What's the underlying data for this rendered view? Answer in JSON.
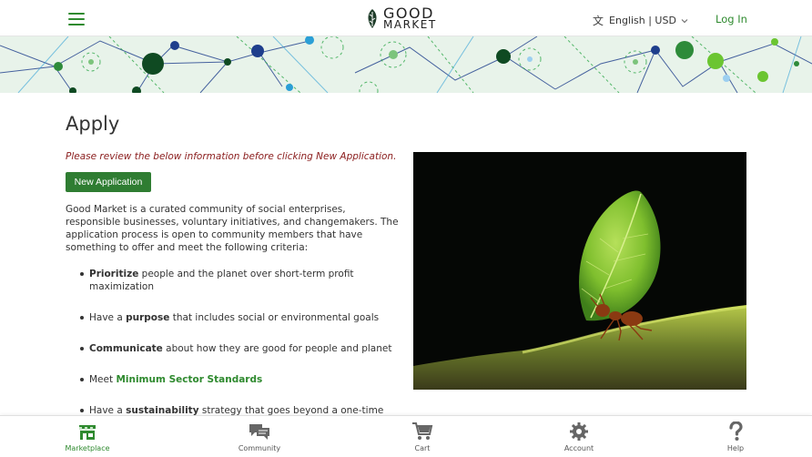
{
  "header": {
    "logo_line1": "GOOD",
    "logo_line2": "MARKET",
    "language": "English",
    "currency": "USD",
    "language_currency": "English | USD",
    "login_label": "Log In"
  },
  "main": {
    "title": "Apply",
    "notice": "Please review the below information before clicking New Application.",
    "new_application_label": "New Application",
    "intro": "Good Market is a curated community of social enterprises, responsible businesses, voluntary initiatives, and changemakers. The application process is open to community members that have something to offer and meet the following criteria:",
    "criteria": [
      {
        "prefix": "",
        "bold": "Prioritize",
        "suffix": " people and the planet over short-term profit maximization"
      },
      {
        "prefix": "Have a ",
        "bold": "purpose",
        "suffix": " that includes social or environmental goals"
      },
      {
        "prefix": "",
        "bold": "Communicate",
        "suffix": " about how they are good for people and planet"
      },
      {
        "prefix": "Meet ",
        "link": "Minimum Sector Standards",
        "suffix": ""
      },
      {
        "prefix": "Have a ",
        "bold": "sustainability",
        "suffix": " strategy that goes beyond a one-time project or event"
      }
    ]
  },
  "bottom_nav": {
    "items": [
      {
        "label": "Marketplace",
        "icon": "storefront-icon",
        "active": true
      },
      {
        "label": "Community",
        "icon": "chat-bubbles-icon",
        "active": false
      },
      {
        "label": "Cart",
        "icon": "cart-icon",
        "active": false
      },
      {
        "label": "Account",
        "icon": "gear-icon",
        "active": false
      },
      {
        "label": "Help",
        "icon": "question-mark-icon",
        "active": false
      }
    ]
  },
  "colors": {
    "brand_green": "#2f8a2f",
    "button_green": "#2f7d32",
    "notice_red": "#8a1c1c"
  }
}
